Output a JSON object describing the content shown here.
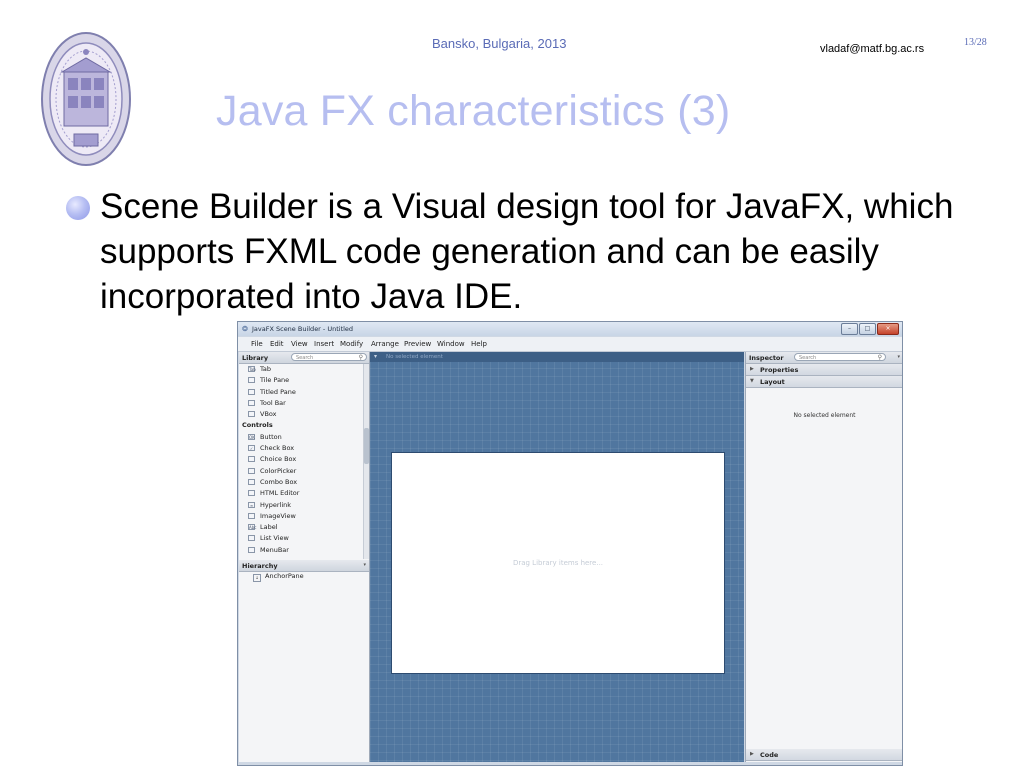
{
  "header": {
    "location": "Bansko, Bulgaria, 2013",
    "email": "vladaf@matf.bg.ac.rs",
    "page": "13/28"
  },
  "slide": {
    "title": "Java FX characteristics (3)",
    "bullet": "Scene Builder is a Visual design tool for JavaFX, which supports FXML code generation and can be easily incorporated into Java IDE."
  },
  "colors": {
    "title": "#b6bef0",
    "header_text": "#5a6bb6",
    "canvas_bg": "#50769f"
  },
  "app": {
    "window_title": "JavaFX Scene Builder - Untitled",
    "menu": [
      "File",
      "Edit",
      "View",
      "Insert",
      "Modify",
      "Arrange",
      "Preview",
      "Window",
      "Help"
    ],
    "library": {
      "title": "Library",
      "search_placeholder": "Search",
      "items": [
        {
          "label": "Tab",
          "icon": "Tab"
        },
        {
          "label": "Tile Pane",
          "icon": ""
        },
        {
          "label": "Titled Pane",
          "icon": ""
        },
        {
          "label": "Tool Bar",
          "icon": ""
        },
        {
          "label": "VBox",
          "icon": ""
        },
        {
          "label": "Controls",
          "icon": "",
          "category": true
        },
        {
          "label": "Button",
          "icon": "OK"
        },
        {
          "label": "Check Box",
          "icon": "✓"
        },
        {
          "label": "Choice Box",
          "icon": ""
        },
        {
          "label": "ColorPicker",
          "icon": ""
        },
        {
          "label": "Combo Box",
          "icon": ""
        },
        {
          "label": "HTML Editor",
          "icon": ""
        },
        {
          "label": "Hyperlink",
          "icon": "∞"
        },
        {
          "label": "ImageView",
          "icon": ""
        },
        {
          "label": "Label",
          "icon": "Abc"
        },
        {
          "label": "List View",
          "icon": ""
        },
        {
          "label": "MenuBar",
          "icon": ""
        }
      ]
    },
    "hierarchy": {
      "title": "Hierarchy",
      "items": [
        {
          "label": "AnchorPane",
          "icon": "↓"
        }
      ]
    },
    "content": {
      "header_label": "No selected element",
      "canvas_hint": "Drag Library items here..."
    },
    "inspector": {
      "title": "Inspector",
      "search_placeholder": "Search",
      "sections": [
        "Properties",
        "Layout"
      ],
      "no_selection": "No selected element",
      "code_section": "Code"
    },
    "window_buttons": [
      "–",
      "□",
      "×"
    ]
  }
}
